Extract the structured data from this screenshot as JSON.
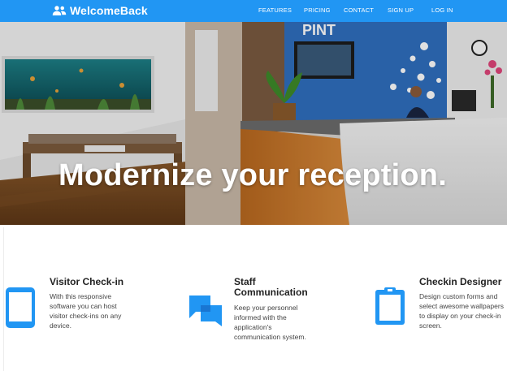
{
  "brand": {
    "name": "WelcomeBack",
    "icon": "people-icon"
  },
  "nav": [
    {
      "label": "FEATURES"
    },
    {
      "label": "PRICING"
    },
    {
      "label": "CONTACT"
    },
    {
      "label": "SIGN UP"
    },
    {
      "label": "LOG IN"
    }
  ],
  "hero": {
    "title": "Modernize your reception.",
    "sign_text": "PINT"
  },
  "features": [
    {
      "icon": "tablet-icon",
      "title": "Visitor Check-in",
      "description": "With this responsive software you can host visitor check-ins on any device."
    },
    {
      "icon": "chat-icon",
      "title": "Staff Communication",
      "description": "Keep your personnel informed with the application's communication system."
    },
    {
      "icon": "clipboard-icon",
      "title": "Checkin Designer",
      "description": "Design custom forms and select awesome wallpapers to display on your check-in screen."
    }
  ],
  "colors": {
    "primary": "#2196f3",
    "icon": "#2196f3"
  }
}
